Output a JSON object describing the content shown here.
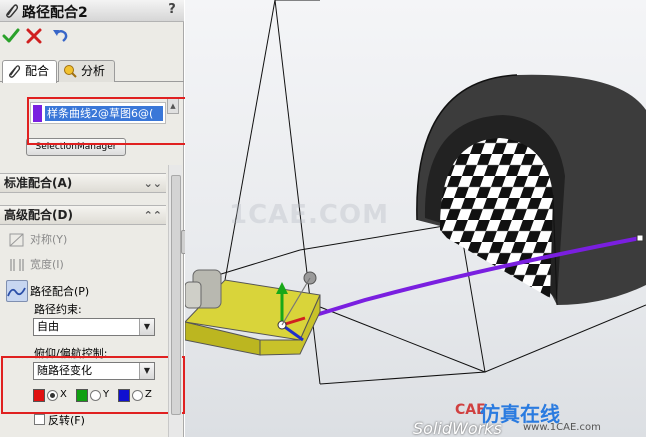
{
  "panel": {
    "title": "路径配合2",
    "help": "?",
    "actions": {
      "ok": "ok-icon",
      "cancel": "cancel-icon",
      "undo": "undo-icon"
    },
    "tabs": [
      {
        "label": "配合",
        "icon": "paperclip-icon",
        "active": true
      },
      {
        "label": "分析",
        "icon": "analysis-icon",
        "active": false
      }
    ],
    "selection": {
      "item": "样条曲线2@草图6@(",
      "item_color": "#7a1fe0",
      "manager_button": "SelectionManager"
    },
    "groups": {
      "standard": "标准配合(A)",
      "advanced": "高级配合(D)"
    },
    "advanced_options": {
      "symmetric": "对称(Y)",
      "width": "宽度(I)",
      "path": "路径配合(P)",
      "path_constraint_label": "路径约束:",
      "path_constraint_value": "自由",
      "pitch_yaw_label": "俯仰/偏航控制:",
      "pitch_yaw_value": "随路径变化",
      "axes": [
        {
          "label": "X",
          "color": "#e01010",
          "selected": true
        },
        {
          "label": "Y",
          "color": "#10a010",
          "selected": false
        },
        {
          "label": "Z",
          "color": "#1010d0",
          "selected": false
        }
      ],
      "flip": "反转(F)"
    }
  },
  "viewport": {
    "watermark": "1CAE.COM",
    "brand_cae": "CAE",
    "brand_cn": "仿真在线",
    "brand_site": "www.1CAE.com",
    "brand_sw": "SolidWorks"
  }
}
